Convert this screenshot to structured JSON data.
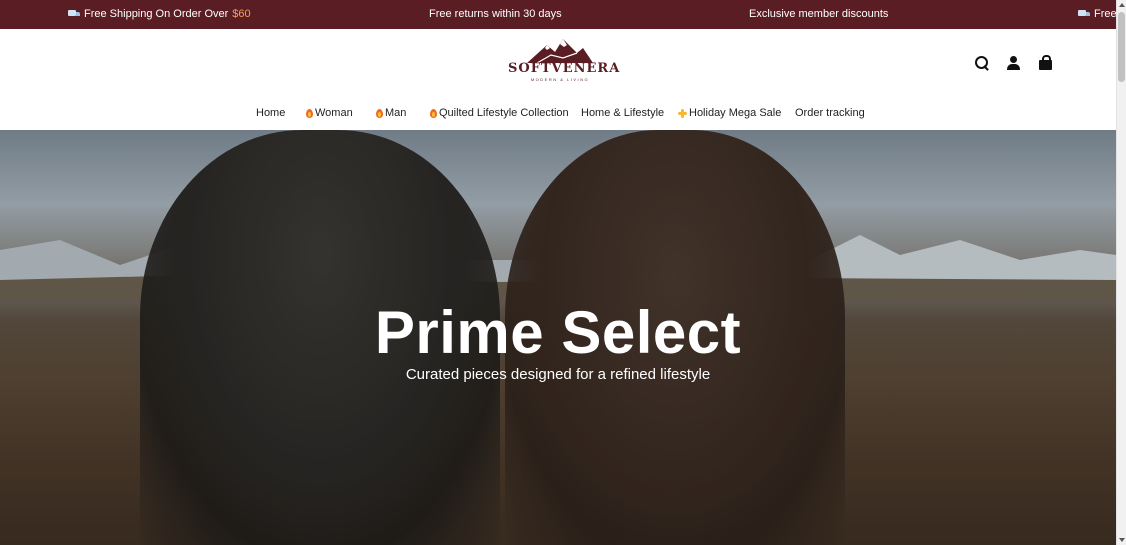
{
  "announcement": {
    "messages": [
      {
        "text": "Free Shipping On Order Over",
        "price": "$60",
        "icon": "truck-icon"
      },
      {
        "text": "Free returns within 30 days"
      },
      {
        "text": "Exclusive member discounts"
      },
      {
        "text": "Free S",
        "icon": "truck-icon"
      }
    ],
    "colors": {
      "background": "#5a1d24",
      "price": "#f0a35b"
    }
  },
  "header": {
    "logo": {
      "brand": "SOFTVENERA",
      "tagline": "MODERN & LIVING"
    },
    "icons": [
      "search-icon",
      "account-icon",
      "bag-icon"
    ]
  },
  "nav": {
    "items": [
      {
        "label": "Home",
        "icon": null
      },
      {
        "label": "Woman",
        "icon": "flame-icon"
      },
      {
        "label": "Man",
        "icon": "flame-icon"
      },
      {
        "label": "Quilted Lifestyle Collection",
        "icon": "flame-icon"
      },
      {
        "label": "Home & Lifestyle",
        "icon": null
      },
      {
        "label": "Holiday Mega Sale",
        "icon": "sparkle-icon"
      },
      {
        "label": "Order tracking",
        "icon": null
      }
    ]
  },
  "hero": {
    "title": "Prime Select",
    "subtitle": "Curated pieces designed for a refined lifestyle"
  }
}
